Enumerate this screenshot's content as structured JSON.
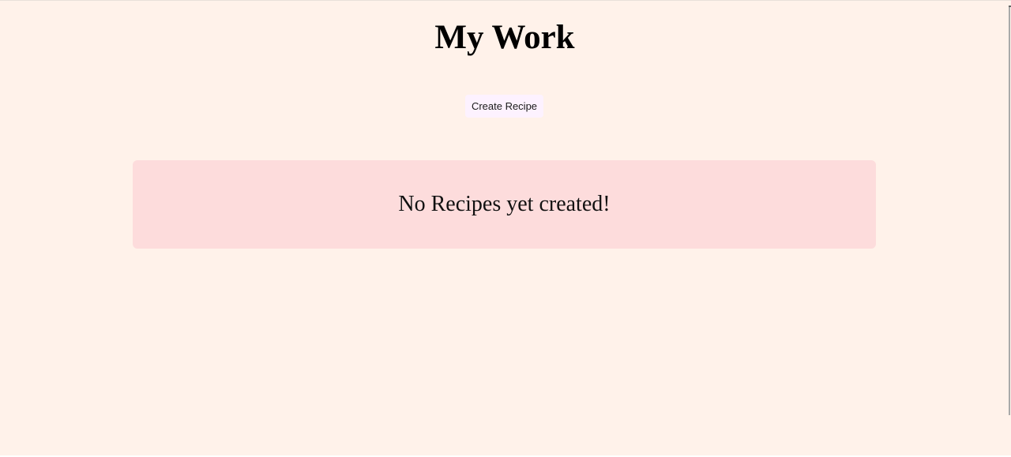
{
  "header": {
    "title": "My Work"
  },
  "actions": {
    "create_label": "Create Recipe"
  },
  "recipes": {
    "items": [],
    "empty_message": "No Recipes yet created!"
  },
  "colors": {
    "background": "#fff2ea",
    "button_background": "#fdf2ff",
    "empty_panel_background": "#fddcdc",
    "text": "#000000"
  }
}
